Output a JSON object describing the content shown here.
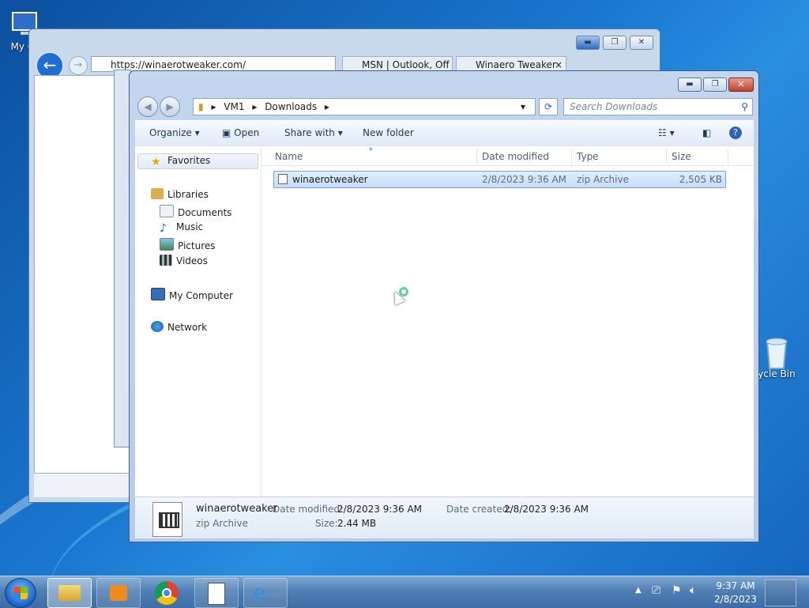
{
  "desktop": {
    "icons": [
      {
        "label": "My Co",
        "icon": "computer-icon"
      },
      {
        "label": "ycle Bin",
        "icon": "recycle-bin-icon"
      }
    ]
  },
  "browser": {
    "url": "https://winaerotweaker.com/",
    "tabs": [
      {
        "label": "MSN | Outlook, Off"
      },
      {
        "label": "Winaero Tweaker"
      }
    ],
    "tab_close": "×"
  },
  "explorer": {
    "breadcrumb": [
      "VM1",
      "Downloads"
    ],
    "search_placeholder": "Search Downloads",
    "toolbar": {
      "organize": "Organize",
      "open": "Open",
      "share_with": "Share with",
      "new_folder": "New folder"
    },
    "nav": {
      "favorites": "Favorites",
      "libraries": "Libraries",
      "documents": "Documents",
      "music": "Music",
      "pictures": "Pictures",
      "videos": "Videos",
      "computer": "My Computer",
      "network": "Network"
    },
    "columns": {
      "name": "Name",
      "date_modified": "Date modified",
      "type": "Type",
      "size": "Size"
    },
    "files": [
      {
        "name": "winaerotweaker",
        "date_modified": "2/8/2023 9:36 AM",
        "type": "zip Archive",
        "size": "2,505 KB"
      }
    ],
    "details": {
      "name": "winaerotweaker",
      "type": "zip Archive",
      "date_modified_label": "Date modified:",
      "date_modified": "2/8/2023 9:36 AM",
      "date_created_label": "Date created:",
      "date_created": "2/8/2023 9:36 AM",
      "size_label": "Size:",
      "size": "2.44 MB"
    }
  },
  "taskbar": {
    "time": "9:37 AM",
    "date": "2/8/2023"
  }
}
